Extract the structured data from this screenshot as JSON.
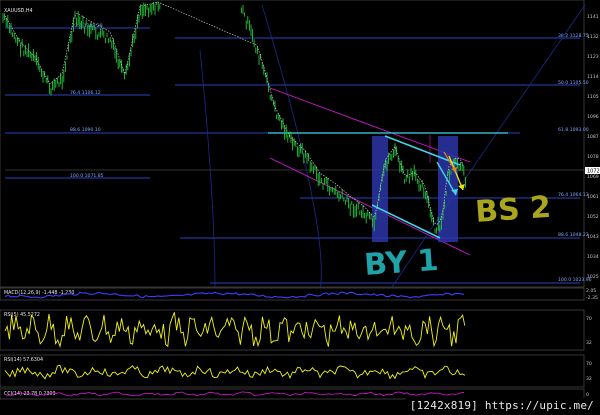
{
  "symbol_title": "XAUUSD,H4",
  "fib_levels": [
    {
      "label": "38.2  1128.75",
      "price": 1128.75,
      "side": "right"
    },
    {
      "label": "23.6  1109.28",
      "price": 1109.28,
      "side": "left-top"
    },
    {
      "label": "50.0  1105.50",
      "price": 1105.5,
      "side": "right"
    },
    {
      "label": "76.4  1106.12",
      "price": 1106.12,
      "side": "left"
    },
    {
      "label": "61.8  1093.00",
      "price": 1093.0,
      "side": "right"
    },
    {
      "label": "88.6  1090.10",
      "price": 1090.1,
      "side": "left"
    },
    {
      "label": "100.0  1071.85",
      "price": 1071.85,
      "side": "left"
    },
    {
      "label": "76.4  1064.13",
      "price": 1064.13,
      "side": "right"
    },
    {
      "label": "88.6  1048.22",
      "price": 1048.22,
      "side": "right"
    },
    {
      "label": "100.0  1023.96",
      "price": 1023.96,
      "side": "right"
    }
  ],
  "price_axis": [
    "1141",
    "1132",
    "1123",
    "1114",
    "1105",
    "1096",
    "1087",
    "1078",
    "1069",
    "1061",
    "1052",
    "1043",
    "1034",
    "1025"
  ],
  "current_price": "1072",
  "annotations": {
    "by": "BY 1",
    "bs": "BS 2"
  },
  "panels": {
    "macd": {
      "label": "MACD(12,26,9) -1.448 -1.230",
      "scale": [
        "2.05",
        "0.00",
        "-2.35"
      ]
    },
    "rsi1": {
      "label": "RSI(5) 45.5272",
      "scale": [
        "70",
        "32"
      ]
    },
    "rsi2": {
      "label": "RSI(14) 57.6304",
      "scale": [
        "70",
        "32"
      ]
    },
    "bottom": {
      "label": "CCI(14) 23.78  0.2309",
      "scale": [
        "0"
      ]
    }
  },
  "stamp": "[1242x819] https://upic.me/",
  "colors": {
    "candles": "#22c83a",
    "fib_line": "#3a5bff",
    "channel": "#d21ad2",
    "box": "#2b36a8",
    "cyan": "#41d6e6",
    "yellow": "#e4e412",
    "macd": "#3d3dff",
    "rsi": "#f2f218",
    "teal_text": "#1fa3a8",
    "olive_text": "#a9a51c"
  }
}
